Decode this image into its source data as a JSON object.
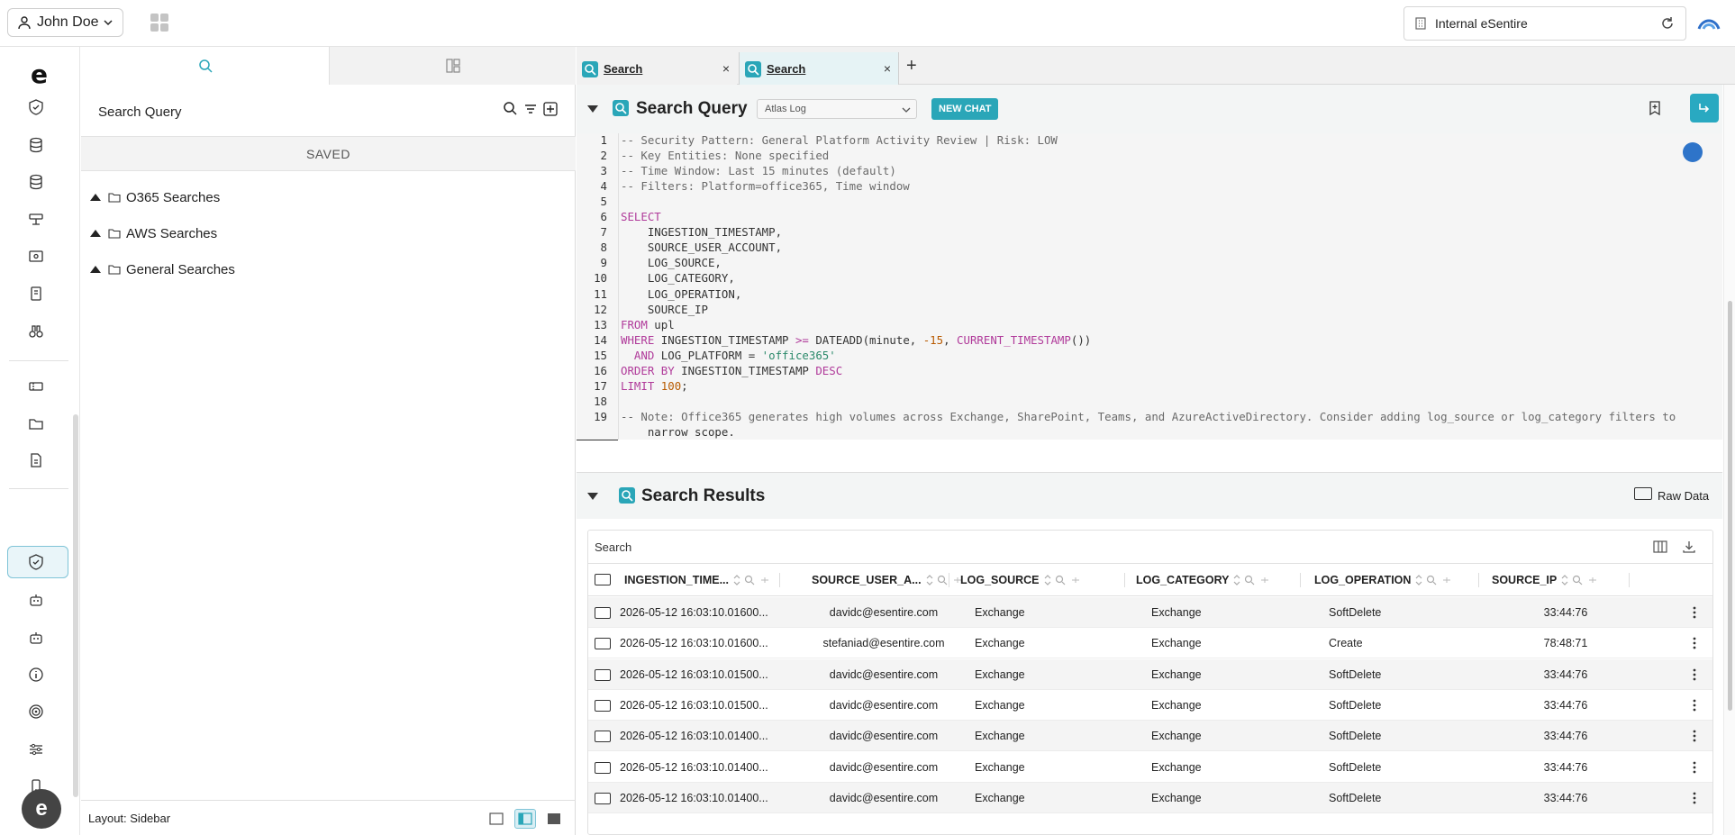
{
  "user": {
    "name": "John Doe"
  },
  "tenant": {
    "name": "Internal eSentire"
  },
  "panel": {
    "title": "Search Query",
    "saved_label": "SAVED",
    "folders": [
      {
        "name": "O365 Searches"
      },
      {
        "name": "AWS Searches"
      },
      {
        "name": "General Searches"
      }
    ],
    "layout_label": "Layout: Sidebar"
  },
  "tabs": [
    {
      "label": "Search"
    },
    {
      "label": "Search"
    }
  ],
  "query": {
    "title": "Search Query",
    "source": "Atlas Log",
    "new_chat": "NEW CHAT",
    "lines": [
      "-- Security Pattern: General Platform Activity Review | Risk: LOW",
      "-- Key Entities: None specified",
      "-- Time Window: Last 15 minutes (default)",
      "-- Filters: Platform=office365, Time window",
      "",
      "SELECT",
      "    INGESTION_TIMESTAMP,",
      "    SOURCE_USER_ACCOUNT,",
      "    LOG_SOURCE,",
      "    LOG_CATEGORY,",
      "    LOG_OPERATION,",
      "    SOURCE_IP",
      "FROM upl",
      "WHERE INGESTION_TIMESTAMP >= DATEADD(minute, -15, CURRENT_TIMESTAMP())",
      "  AND LOG_PLATFORM = 'office365'",
      "ORDER BY INGESTION_TIMESTAMP DESC",
      "LIMIT 100;",
      "",
      "-- Note: Office365 generates high volumes across Exchange, SharePoint, Teams, and AzureActiveDirectory. Consider adding log_source or log_category filters to",
      "    narrow scope."
    ],
    "line_numbers": [
      "1",
      "2",
      "3",
      "4",
      "5",
      "6",
      "7",
      "8",
      "9",
      "10",
      "11",
      "12",
      "13",
      "14",
      "15",
      "16",
      "17",
      "18",
      "19"
    ]
  },
  "results": {
    "title": "Search Results",
    "raw_data_label": "Raw Data",
    "search_label": "Search",
    "columns": [
      "INGESTION_TIME...",
      "SOURCE_USER_A...",
      "LOG_SOURCE",
      "LOG_CATEGORY",
      "LOG_OPERATION",
      "SOURCE_IP"
    ],
    "rows": [
      [
        "2026-05-12 16:03:10.01600...",
        "davidc@esentire.com",
        "Exchange",
        "Exchange",
        "SoftDelete",
        "33:44:76"
      ],
      [
        "2026-05-12 16:03:10.01600...",
        "stefaniad@esentire.com",
        "Exchange",
        "Exchange",
        "Create",
        "78:48:71"
      ],
      [
        "2026-05-12 16:03:10.01500...",
        "davidc@esentire.com",
        "Exchange",
        "Exchange",
        "SoftDelete",
        "33:44:76"
      ],
      [
        "2026-05-12 16:03:10.01500...",
        "davidc@esentire.com",
        "Exchange",
        "Exchange",
        "SoftDelete",
        "33:44:76"
      ],
      [
        "2026-05-12 16:03:10.01400...",
        "davidc@esentire.com",
        "Exchange",
        "Exchange",
        "SoftDelete",
        "33:44:76"
      ],
      [
        "2026-05-12 16:03:10.01400...",
        "davidc@esentire.com",
        "Exchange",
        "Exchange",
        "SoftDelete",
        "33:44:76"
      ],
      [
        "2026-05-12 16:03:10.01400...",
        "davidc@esentire.com",
        "Exchange",
        "Exchange",
        "SoftDelete",
        "33:44:76"
      ]
    ]
  },
  "colors": {
    "accent": "#2aa6b8",
    "active_tab": "#e6f3f5",
    "nav_active": "#e9f5f9"
  }
}
